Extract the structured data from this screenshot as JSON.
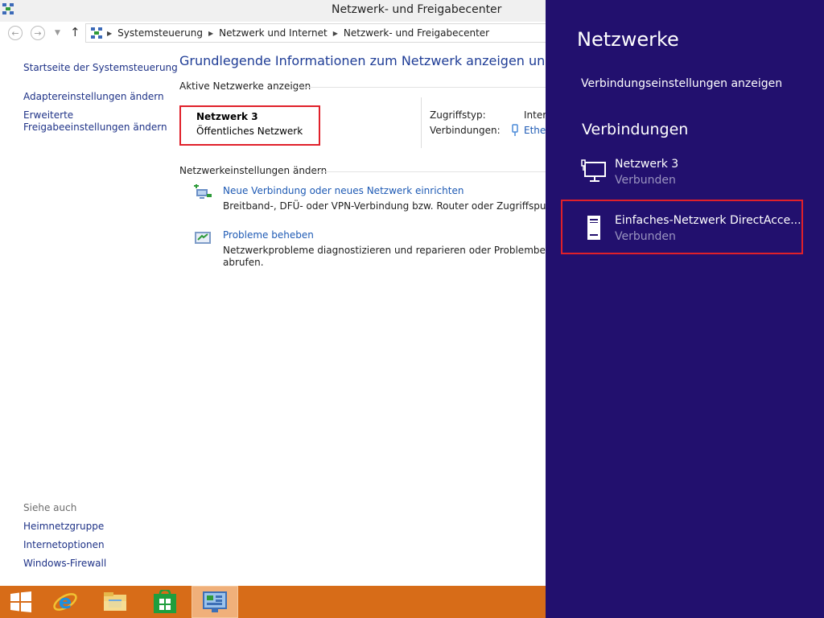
{
  "window": {
    "title": "Netzwerk- und Freigabecenter"
  },
  "address_bar": {
    "breadcrumbs": [
      "Systemsteuerung",
      "Netzwerk und Internet",
      "Netzwerk- und Freigabecenter"
    ]
  },
  "sidebar": {
    "links": [
      "Startseite der Systemsteuerung",
      "Adaptereinstellungen ändern",
      "Erweiterte",
      "Freigabeeinstellungen ändern"
    ],
    "see_also_label": "Siehe auch",
    "see_also_links": [
      "Heimnetzgruppe",
      "Internetoptionen",
      "Windows-Firewall"
    ]
  },
  "main": {
    "title": "Grundlegende Informationen zum Netzwerk anzeigen und Verbin",
    "active_networks_label": "Aktive Netzwerke anzeigen",
    "network": {
      "name": "Netzwerk  3",
      "type": "Öffentliches Netzwerk"
    },
    "details": {
      "access_type_label": "Zugriffstyp:",
      "access_type_value": "Intern",
      "connections_label": "Verbindungen:",
      "connections_value": "Ether"
    },
    "change_settings_label": "Netzwerkeinstellungen ändern",
    "tasks": [
      {
        "title": "Neue Verbindung oder neues Netzwerk einrichten",
        "desc": [
          "Breitband-, DFÜ- oder VPN-Verbindung bzw. Router oder Zugriffspunkt einri"
        ]
      },
      {
        "title": "Probleme beheben",
        "desc": [
          "Netzwerkprobleme diagnostizieren und reparieren oder Problembehandlung",
          "abrufen."
        ]
      }
    ]
  },
  "taskbar": {
    "items": [
      "start-icon",
      "internet-explorer-icon",
      "file-explorer-icon",
      "store-icon",
      "control-panel-icon"
    ],
    "colors": {
      "background": "#d76c18",
      "active": "#f0b07a"
    }
  },
  "charm": {
    "title": "Netzwerke",
    "settings_link": "Verbindungseinstellungen anzeigen",
    "connections_heading": "Verbindungen",
    "connections": [
      {
        "name": "Netzwerk  3",
        "status": "Verbunden",
        "icon": "wired-network-icon"
      },
      {
        "name": "Einfaches-Netzwerk DirectAcce...",
        "status": "Verbunden",
        "icon": "directaccess-icon"
      }
    ],
    "colors": {
      "background": "#22106e",
      "status": "#9a94c0",
      "highlight": "#e0202a"
    }
  }
}
